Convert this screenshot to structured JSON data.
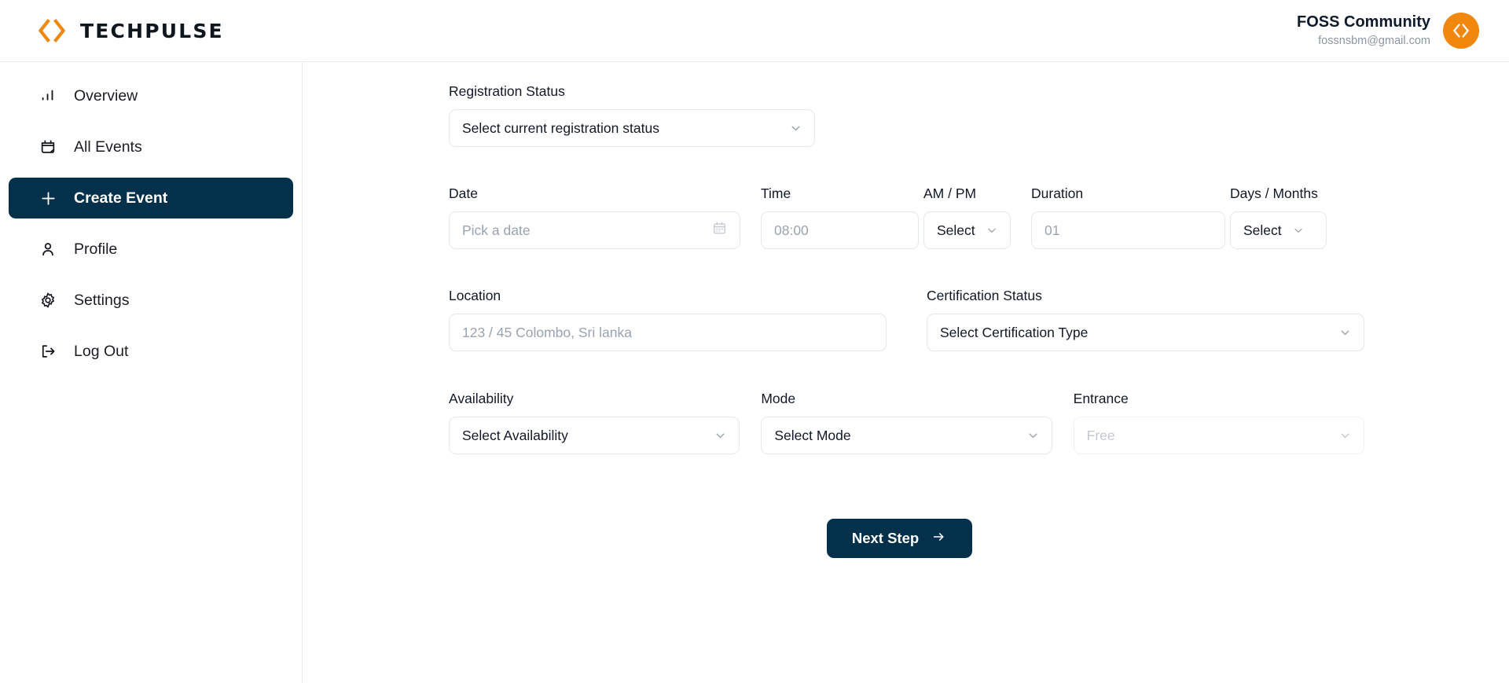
{
  "app": {
    "brand_name": "TECHPULSE",
    "accent_color": "#f2870d",
    "primary_color": "#03304a"
  },
  "header": {
    "user_name": "FOSS Community",
    "user_email": "fossnsbm@gmail.com",
    "avatar_icon": "code-brackets-icon",
    "logo_icon": "code-brackets-icon"
  },
  "sidebar": {
    "items": [
      {
        "label": "Overview",
        "icon": "bar-chart-icon",
        "active": false
      },
      {
        "label": "All Events",
        "icon": "calendar-icon",
        "active": false
      },
      {
        "label": "Create Event",
        "icon": "plus-icon",
        "active": true
      },
      {
        "label": "Profile",
        "icon": "user-icon",
        "active": false
      },
      {
        "label": "Settings",
        "icon": "gear-icon",
        "active": false
      },
      {
        "label": "Log Out",
        "icon": "logout-icon",
        "active": false
      }
    ]
  },
  "form": {
    "registration_status": {
      "label": "Registration Status",
      "value": "Select current registration status",
      "is_placeholder": false,
      "icon": "chevron-down-icon"
    },
    "date": {
      "label": "Date",
      "value": "Pick a date",
      "is_placeholder": true,
      "icon": "calendar-icon"
    },
    "time": {
      "label": "Time",
      "value": "08:00",
      "is_placeholder": true
    },
    "am_pm": {
      "label": "AM / PM",
      "value": "Select",
      "is_placeholder": false,
      "icon": "chevron-down-icon"
    },
    "duration": {
      "label": "Duration",
      "value": "01",
      "is_placeholder": true
    },
    "days_months": {
      "label": "Days / Months",
      "value": "Select",
      "is_placeholder": false,
      "icon": "chevron-down-icon"
    },
    "location": {
      "label": "Location",
      "value": "123 / 45 Colombo, Sri lanka",
      "is_placeholder": true
    },
    "certification_status": {
      "label": "Certification Status",
      "value": "Select Certification Type",
      "is_placeholder": false,
      "icon": "chevron-down-icon"
    },
    "availability": {
      "label": "Availability",
      "value": "Select Availability",
      "is_placeholder": false,
      "icon": "chevron-down-icon"
    },
    "mode": {
      "label": "Mode",
      "value": "Select Mode",
      "is_placeholder": false,
      "icon": "chevron-down-icon"
    },
    "entrance": {
      "label": "Entrance",
      "value": "Free",
      "is_placeholder": true,
      "disabled": true,
      "icon": "chevron-down-icon"
    },
    "next_button": {
      "label": "Next Step",
      "icon": "arrow-right-icon"
    }
  }
}
